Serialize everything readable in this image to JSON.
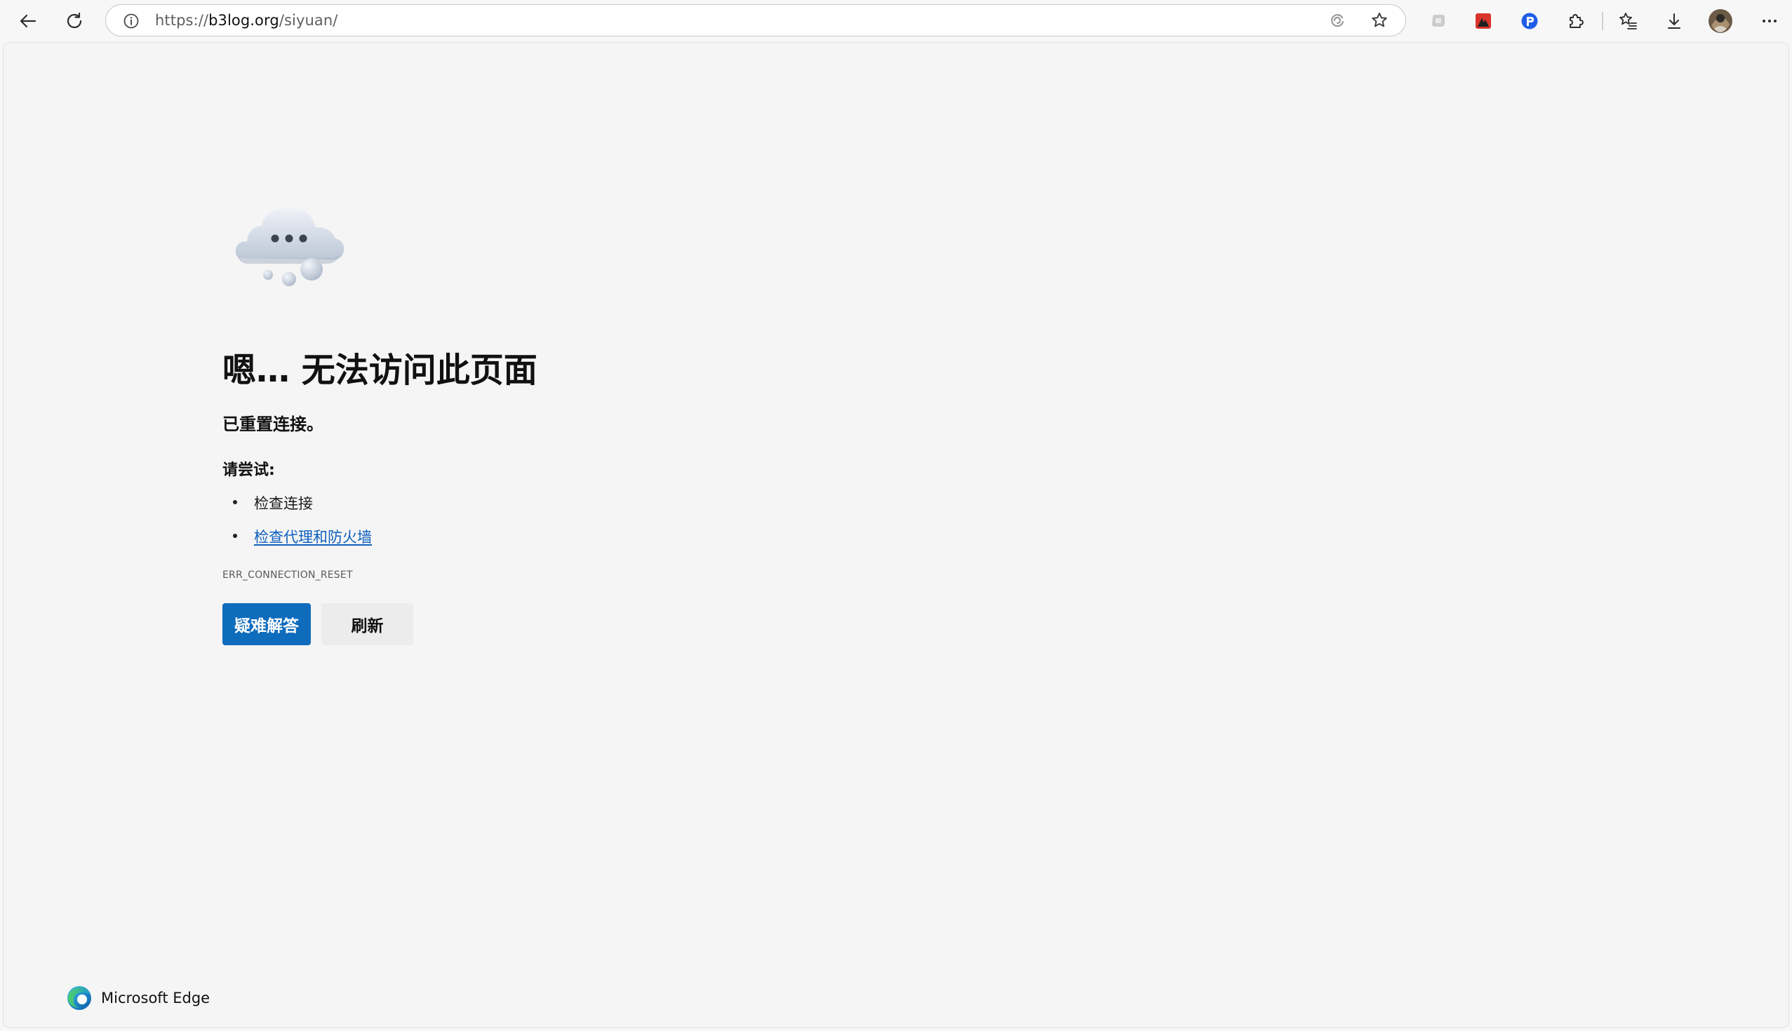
{
  "browser": {
    "url_prefix": "https://",
    "url_host": "b3log.org",
    "url_path": "/siyuan/",
    "brand_name": "Microsoft Edge"
  },
  "error_page": {
    "title": "嗯… 无法访问此页面",
    "subtitle": "已重置连接。",
    "try_label": "请尝试:",
    "suggestions": [
      {
        "text": "检查连接",
        "is_link": false
      },
      {
        "text": "检查代理和防火墙",
        "is_link": true
      }
    ],
    "error_code": "ERR_CONNECTION_RESET",
    "primary_button": "疑难解答",
    "secondary_button": "刷新"
  },
  "colors": {
    "accent": "#0f6cbd",
    "link": "#0d5fbf",
    "page_background": "#f5f5f5"
  },
  "icons": [
    "back-icon",
    "refresh-icon",
    "info-icon",
    "read-aloud-icon",
    "favorite-star-icon",
    "copilot-icon",
    "extension-red-icon",
    "extension-blue-icon",
    "extensions-puzzle-icon",
    "favorites-icon",
    "download-icon",
    "profile-avatar",
    "more-icon",
    "cloud-icon",
    "edge-logo-icon"
  ]
}
